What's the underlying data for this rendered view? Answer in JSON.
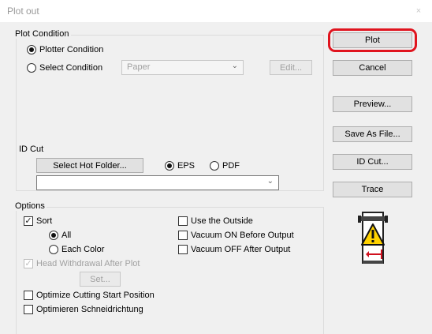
{
  "window": {
    "title": "Plot out",
    "close_glyph": "×"
  },
  "plot_condition": {
    "group_label": "Plot Condition",
    "plotter_condition": "Plotter Condition",
    "select_condition": "Select Condition",
    "condition_value": "Paper",
    "edit_label": "Edit...",
    "selected": "plotter_condition"
  },
  "id_cut": {
    "group_label": "ID Cut",
    "select_hot_folder": "Select Hot Folder...",
    "eps": "EPS",
    "pdf": "PDF",
    "format_selected": "EPS",
    "folder_value": ""
  },
  "options": {
    "group_label": "Options",
    "sort": "Sort",
    "sort_checked": true,
    "all": "All",
    "each_color": "Each Color",
    "sort_mode": "All",
    "head_withdrawal": "Head Withdrawal After Plot",
    "head_withdrawal_checked": true,
    "set_label": "Set...",
    "optimize_cutting": "Optimize Cutting Start Position",
    "optimieren": "Optimieren Schneidrichtung",
    "use_outside": "Use the Outside",
    "vacuum_on": "Vacuum ON Before Output",
    "vacuum_off": "Vacuum OFF After Output"
  },
  "actions": {
    "plot": "Plot",
    "cancel": "Cancel",
    "preview": "Preview...",
    "save_as_file": "Save As File...",
    "id_cut": "ID Cut...",
    "trace": "Trace"
  },
  "colors": {
    "highlight": "#e0141e",
    "warning_yellow": "#ffd200"
  },
  "icons": {
    "plotter_warning": "plotter-warning-icon",
    "radio": "radio-button",
    "check": "checkmark"
  }
}
